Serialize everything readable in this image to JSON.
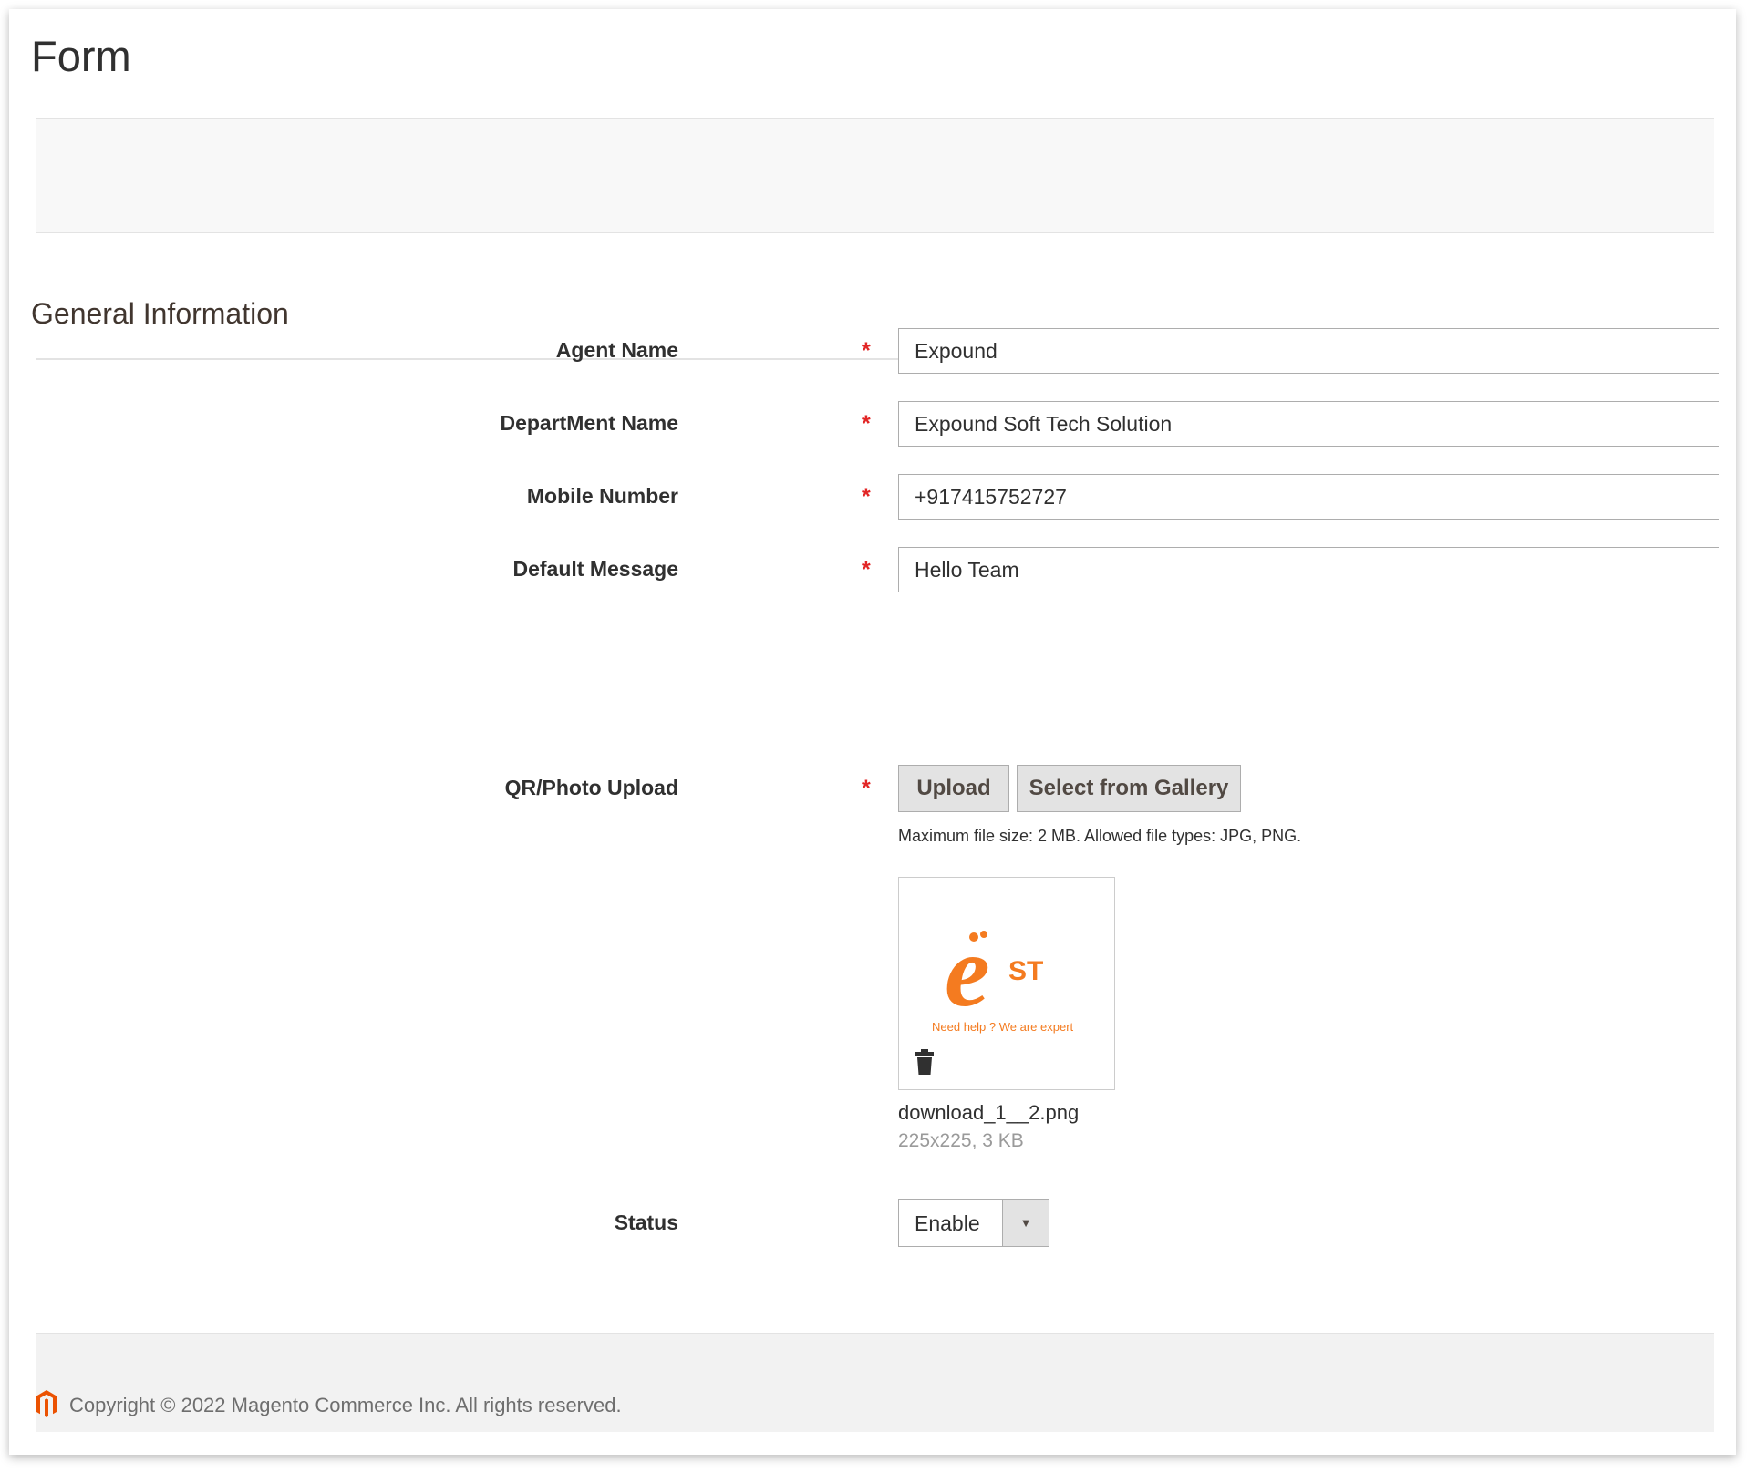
{
  "page": {
    "title": "Form"
  },
  "section": {
    "title": "General Information"
  },
  "fields": {
    "agent_name": {
      "label": "Agent Name",
      "value": "Expound"
    },
    "department_name": {
      "label": "DepartMent Name",
      "value": "Expound Soft Tech Solution"
    },
    "mobile_number": {
      "label": "Mobile Number",
      "value": "+917415752727"
    },
    "default_message": {
      "label": "Default Message",
      "value": "Hello Team"
    },
    "upload": {
      "label": "QR/Photo Upload",
      "upload_button": "Upload",
      "gallery_button": "Select from Gallery",
      "note": "Maximum file size: 2 MB. Allowed file types: JPG, PNG.",
      "file_name": "download_1__2.png",
      "file_meta": "225x225, 3 KB",
      "preview_logo_text": "e",
      "preview_logo_suffix": "ST",
      "preview_tagline": "Need help ? We are expert"
    },
    "status": {
      "label": "Status",
      "value": "Enable"
    }
  },
  "required_marker": "*",
  "footer": {
    "copyright": "Copyright © 2022 Magento Commerce Inc. All rights reserved."
  },
  "colors": {
    "required": "#e22626",
    "brand_orange": "#f47b20",
    "footer_logo": "#eb5202"
  }
}
